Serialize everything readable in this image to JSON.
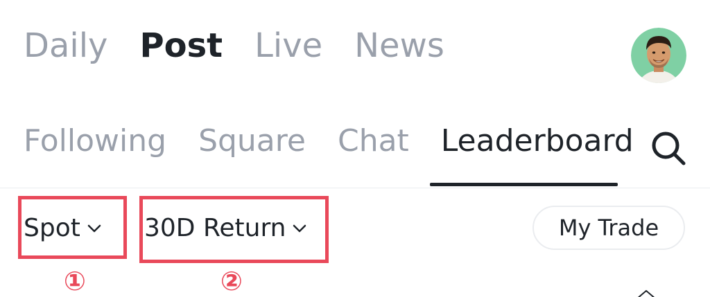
{
  "top_tabs": [
    {
      "label": "Daily",
      "active": false
    },
    {
      "label": "Post",
      "active": true
    },
    {
      "label": "Live",
      "active": false
    },
    {
      "label": "News",
      "active": false
    }
  ],
  "sub_tabs": [
    {
      "label": "Following",
      "active": false
    },
    {
      "label": "Square",
      "active": false
    },
    {
      "label": "Chat",
      "active": false
    },
    {
      "label": "Leaderboard",
      "active": true
    }
  ],
  "filters": {
    "market_label": "Spot",
    "period_label": "30D Return"
  },
  "markers": {
    "first": "①",
    "second": "②"
  },
  "my_trade_label": "My Trade",
  "colors": {
    "active_text": "#1e2329",
    "inactive_text": "#9aa0ab",
    "highlight": "#e9495a",
    "avatar_bg": "#7fd0a4"
  },
  "icons": {
    "search": "search-icon",
    "chevron": "chevron-down-icon",
    "avatar": "avatar"
  }
}
